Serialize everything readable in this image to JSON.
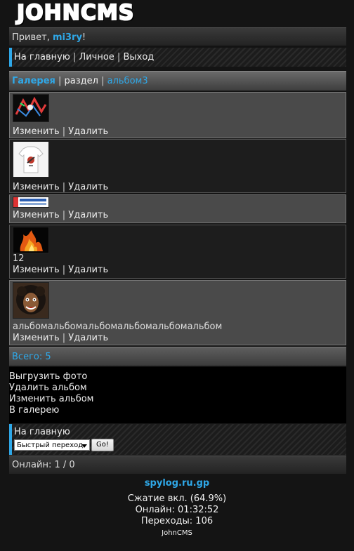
{
  "logo": {
    "text": "JOHNCMS"
  },
  "greeting": {
    "prefix": "Привет, ",
    "user": "mi3ry",
    "suffix": "!"
  },
  "nav": {
    "home": "На главную",
    "personal": "Личное",
    "exit": "Выход",
    "sep": " | "
  },
  "gallery_header": {
    "gallery": "Галерея",
    "section": "раздел",
    "album": "альбом3",
    "sep": " | "
  },
  "items": [
    {
      "thumb_icon": "photo-thumbnail-graffiti",
      "text": "",
      "edit": "Изменить",
      "delete": "Удалить"
    },
    {
      "thumb_icon": "photo-thumbnail-tshirt",
      "text": "",
      "edit": "Изменить",
      "delete": "Удалить"
    },
    {
      "thumb_icon": "photo-thumbnail-spylog-banner",
      "text": "",
      "edit": "Изменить",
      "delete": "Удалить"
    },
    {
      "thumb_icon": "photo-thumbnail-fire",
      "text": "12",
      "edit": "Изменить",
      "delete": "Удалить"
    },
    {
      "thumb_icon": "photo-thumbnail-face",
      "text": "альбомальбомальбомальбомальбомальбом",
      "edit": "Изменить",
      "delete": "Удалить"
    }
  ],
  "action_sep": " | ",
  "total": "Всего: 5",
  "menu": {
    "upload": "Выгрузить фото",
    "delete_album": "Удалить альбом",
    "edit_album": "Изменить альбом",
    "to_gallery": "В галерею"
  },
  "footer_nav": {
    "home": "На главную",
    "quick_jump": "Быстрый переход",
    "go": "Go!"
  },
  "online": "Онлайн: 1 / 0",
  "footer": {
    "spylog": "spylog.ru.gp",
    "compression": "Сжатие вкл. (64.9%)",
    "online_time": "Онлайн: 01:32:52",
    "transitions": "Переходы: 106",
    "cms": "JohnCMS"
  },
  "colors": {
    "accent": "#2fa8e8",
    "background": "#141414"
  }
}
